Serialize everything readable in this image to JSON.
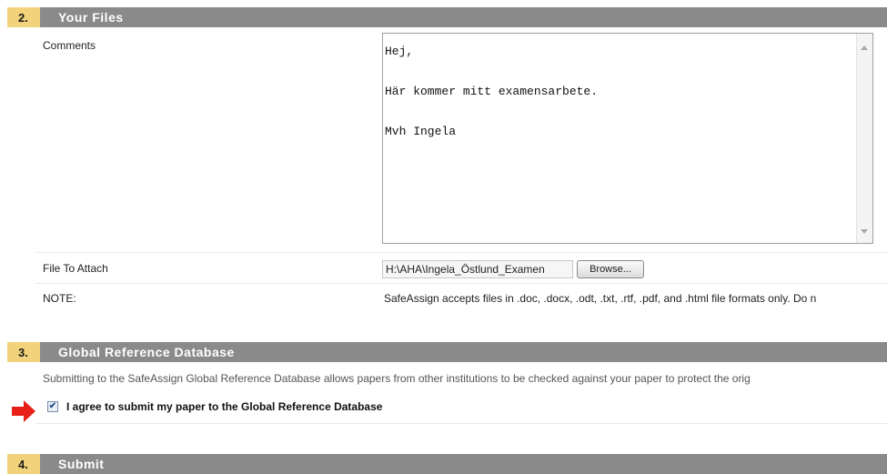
{
  "sections": {
    "your_files": {
      "number": "2.",
      "title": "Your Files"
    },
    "global_db": {
      "number": "3.",
      "title": "Global Reference Database"
    },
    "submit": {
      "number": "4.",
      "title": "Submit"
    }
  },
  "comments": {
    "label": "Comments",
    "value": "Hej,\n\nHär kommer mitt examensarbete.\n\nMvh Ingela"
  },
  "file": {
    "label": "File To Attach",
    "value": "H:\\AHA\\Ingela_Östlund_Examen",
    "browse_label": "Browse..."
  },
  "note": {
    "label": "NOTE:",
    "text": "SafeAssign accepts files in .doc, .docx, .odt, .txt, .rtf, .pdf, and .html file formats only. Do n"
  },
  "global_db": {
    "description": "Submitting to the SafeAssign Global Reference Database allows papers from other institutions to be checked against your paper to protect the orig",
    "agree_label": "I agree to submit my paper to the Global Reference Database",
    "checked": true
  },
  "colors": {
    "section_header_bg": "#8a8a8a",
    "section_number_bg": "#f2d27a",
    "arrow": "#e8201a"
  },
  "icons": {
    "arrow": "red-arrow-icon",
    "checkbox_mark": "✔"
  }
}
